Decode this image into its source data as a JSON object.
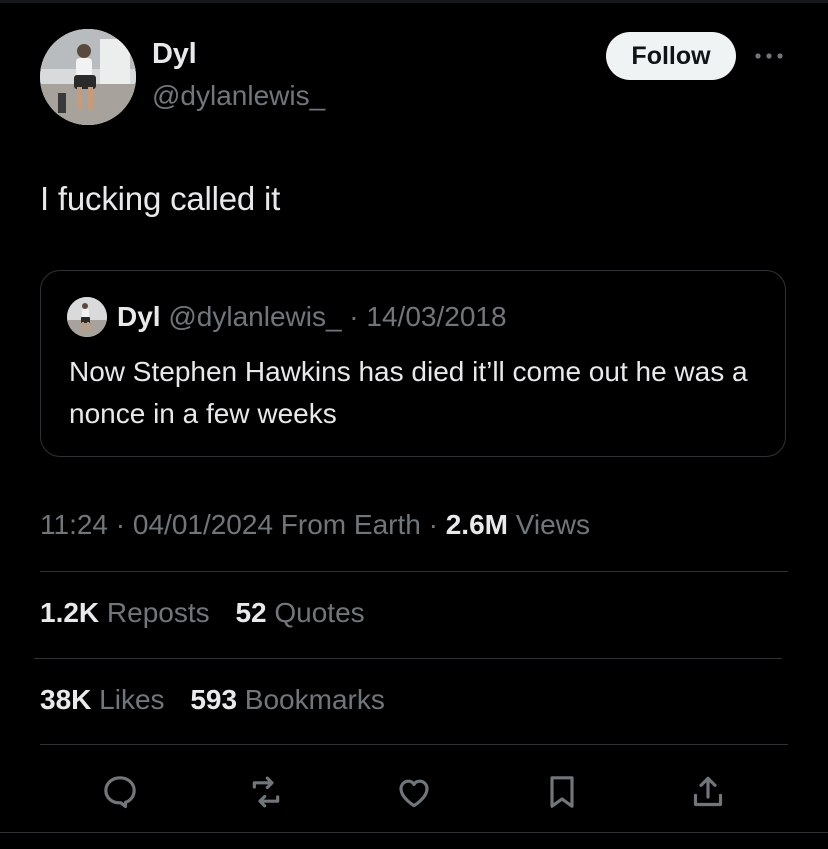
{
  "author": {
    "display_name": "Dyl",
    "handle": "@dylanlewis_"
  },
  "follow_label": "Follow",
  "more_icon": "more-horizontal-icon",
  "tweet_text": "I fucking called it",
  "quoted": {
    "display_name": "Dyl",
    "handle_date": "@dylanlewis_ · 14/03/2018",
    "text": "Now Stephen Hawkins has died it’ll come out he was a nonce in a few weeks"
  },
  "meta": {
    "time": "11:24",
    "sep1": " · ",
    "date": "04/01/2024",
    "location": " From Earth",
    "sep2": " · ",
    "views_count": "2.6M",
    "views_label": " Views"
  },
  "stats": {
    "reposts_count": "1.2K",
    "reposts_label": " Reposts",
    "quotes_count": "52",
    "quotes_label": " Quotes",
    "likes_count": "38K",
    "likes_label": " Likes",
    "bookmarks_count": "593",
    "bookmarks_label": " Bookmarks"
  },
  "actions": [
    "reply-icon",
    "repost-icon",
    "like-icon",
    "bookmark-icon",
    "share-icon"
  ],
  "colors": {
    "background": "#000000",
    "text_primary": "#e7e9ea",
    "text_secondary": "#71767b",
    "border": "#2f3336",
    "follow_bg": "#eff3f4"
  }
}
